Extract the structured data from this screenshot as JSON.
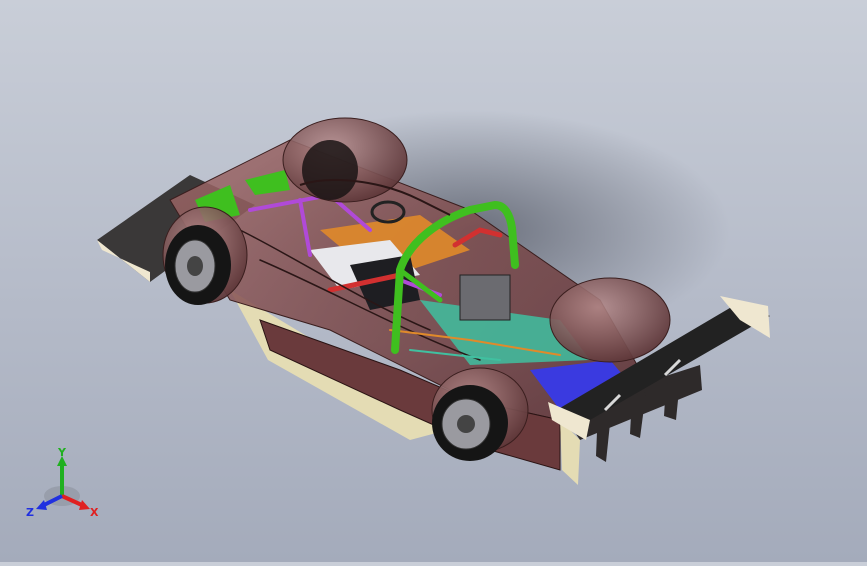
{
  "viewport": {
    "background_top": "#c9ced8",
    "background_bottom": "#a4abbb",
    "model": {
      "icon": "race-car-assembly-icon",
      "body_color": "#7a4a4c",
      "rollcage_color": "#3fbf1f",
      "accent_colors": [
        "#e08a2a",
        "#d23030",
        "#b04ad8",
        "#3a3ae0",
        "#40c0a0"
      ]
    }
  },
  "triad": {
    "x_label": "X",
    "y_label": "Y",
    "z_label": "Z",
    "x_color": "#e02020",
    "y_color": "#20b020",
    "z_color": "#2030e0"
  }
}
